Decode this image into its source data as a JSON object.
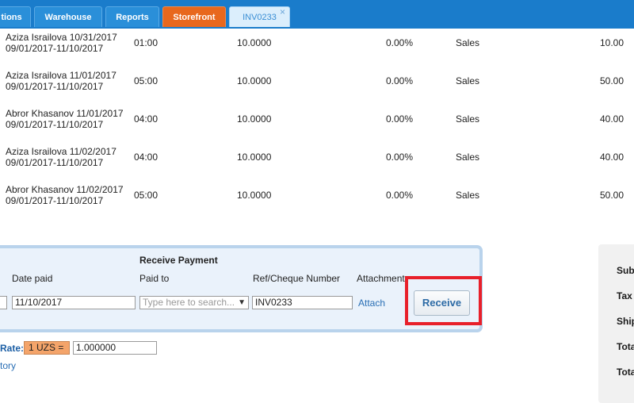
{
  "tabs": [
    {
      "label": "tions"
    },
    {
      "label": "Warehouse"
    },
    {
      "label": "Reports"
    },
    {
      "label": "Storefront"
    },
    {
      "label": "INV0233",
      "close": "×"
    }
  ],
  "rows": [
    {
      "line1": "Aziza Israilova 10/31/2017",
      "line2": "09/01/2017-11/10/2017",
      "hours": "01:00",
      "rate": "10.0000",
      "tax": "0.00%",
      "account": "Sales",
      "amount": "10.00"
    },
    {
      "line1": "Aziza Israilova 11/01/2017",
      "line2": "09/01/2017-11/10/2017",
      "hours": "05:00",
      "rate": "10.0000",
      "tax": "0.00%",
      "account": "Sales",
      "amount": "50.00"
    },
    {
      "line1": "Abror Khasanov 11/01/2017",
      "line2": "09/01/2017-11/10/2017",
      "hours": "04:00",
      "rate": "10.0000",
      "tax": "0.00%",
      "account": "Sales",
      "amount": "40.00"
    },
    {
      "line1": "Aziza Israilova 11/02/2017",
      "line2": "09/01/2017-11/10/2017",
      "hours": "04:00",
      "rate": "10.0000",
      "tax": "0.00%",
      "account": "Sales",
      "amount": "40.00"
    },
    {
      "line1": "Abror Khasanov 11/02/2017",
      "line2": "09/01/2017-11/10/2017",
      "hours": "05:00",
      "rate": "10.0000",
      "tax": "0.00%",
      "account": "Sales",
      "amount": "50.00"
    }
  ],
  "payment": {
    "title": "Receive Payment",
    "date_label": "Date paid",
    "date_value": "11/10/2017",
    "paid_to_label": "Paid to",
    "paid_to_placeholder": "Type here to search...",
    "ref_label": "Ref/Cheque Number",
    "ref_value": "INV0233",
    "attachment_label": "Attachment:",
    "attach_link": "Attach",
    "receive_button": "Receive"
  },
  "exchange": {
    "label": "Rate:",
    "badge": "1 UZS =",
    "value": "1.000000",
    "history_link": "tory"
  },
  "summary": {
    "labels": [
      "Sub",
      "Tax",
      "Ship",
      "Tota",
      "Tota"
    ]
  },
  "colors": {
    "topbar": "#1a7ccb",
    "storefront_tab": "#e8681d",
    "highlight": "#e8202a"
  }
}
